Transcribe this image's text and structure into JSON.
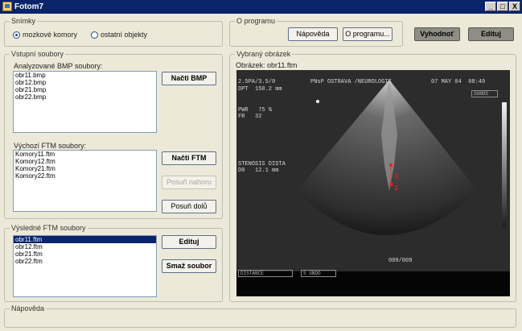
{
  "window": {
    "title": "Fotom7",
    "minimize": "_",
    "maximize": "□",
    "close": "X"
  },
  "snimky": {
    "legend": "Snímky",
    "radio_1": "mozkové komory",
    "radio_2": "ostatní objekty"
  },
  "oprogramu": {
    "legend": "O programu",
    "help_button": "Nápověda",
    "about_button": "O programu..."
  },
  "toolbar": {
    "evaluate_button": "Vyhodnoť",
    "edit_button": "Edituj"
  },
  "vstupni": {
    "legend": "Vstupní soubory",
    "bmp_label": "Analyzované BMP soubory:",
    "bmp_files": [
      "obr11.bmp",
      "obr12.bmp",
      "obr21.bmp",
      "obr22.bmp"
    ],
    "load_bmp_button": "Načti BMP",
    "ftm_label": "Výchozí FTM soubory:",
    "ftm_files": [
      "Komory11.ftm",
      "Komory12.ftm",
      "Komory21.ftm",
      "Komory22.ftm"
    ],
    "load_ftm_button": "Načti FTM",
    "move_up_button": "Posuň nahoru",
    "move_down_button": "Posuň dolů"
  },
  "vysledne": {
    "legend": "Výsledné FTM soubory",
    "files": [
      "obr11.ftm",
      "obr12.ftm",
      "obr21.ftm",
      "obr22.ftm"
    ],
    "selected_index": 0,
    "edit_button": "Edituj",
    "delete_button": "Smaž soubor"
  },
  "obrazek": {
    "legend": "Vybraný obrázek",
    "caption": "Obrázek: obr11.ftm",
    "overlay": {
      "line1": "2.5PA/3.5/0",
      "line2": "DPT  150.2 mm",
      "header": "PNsP OSTRAVA /NEUROLOGIE",
      "date": "07 MAY 04  08:40",
      "line3": "PWR   75 %",
      "line4": "FR   32",
      "box_tr": "SONOS",
      "stenosis": "STENOSIS DISTA",
      "d0": "D0   12.1 mm",
      "marker1": "1",
      "marker2": "2",
      "counter": "009/009",
      "box_bl": "DISTANCE",
      "box_bm": "S UNDO"
    }
  },
  "napoveda": {
    "legend": "Nápověda"
  },
  "colors": {
    "title_bar": "#0a246a",
    "window_bg": "#ece9d8",
    "selection": "#0a246a",
    "marker": "#ff2020"
  }
}
